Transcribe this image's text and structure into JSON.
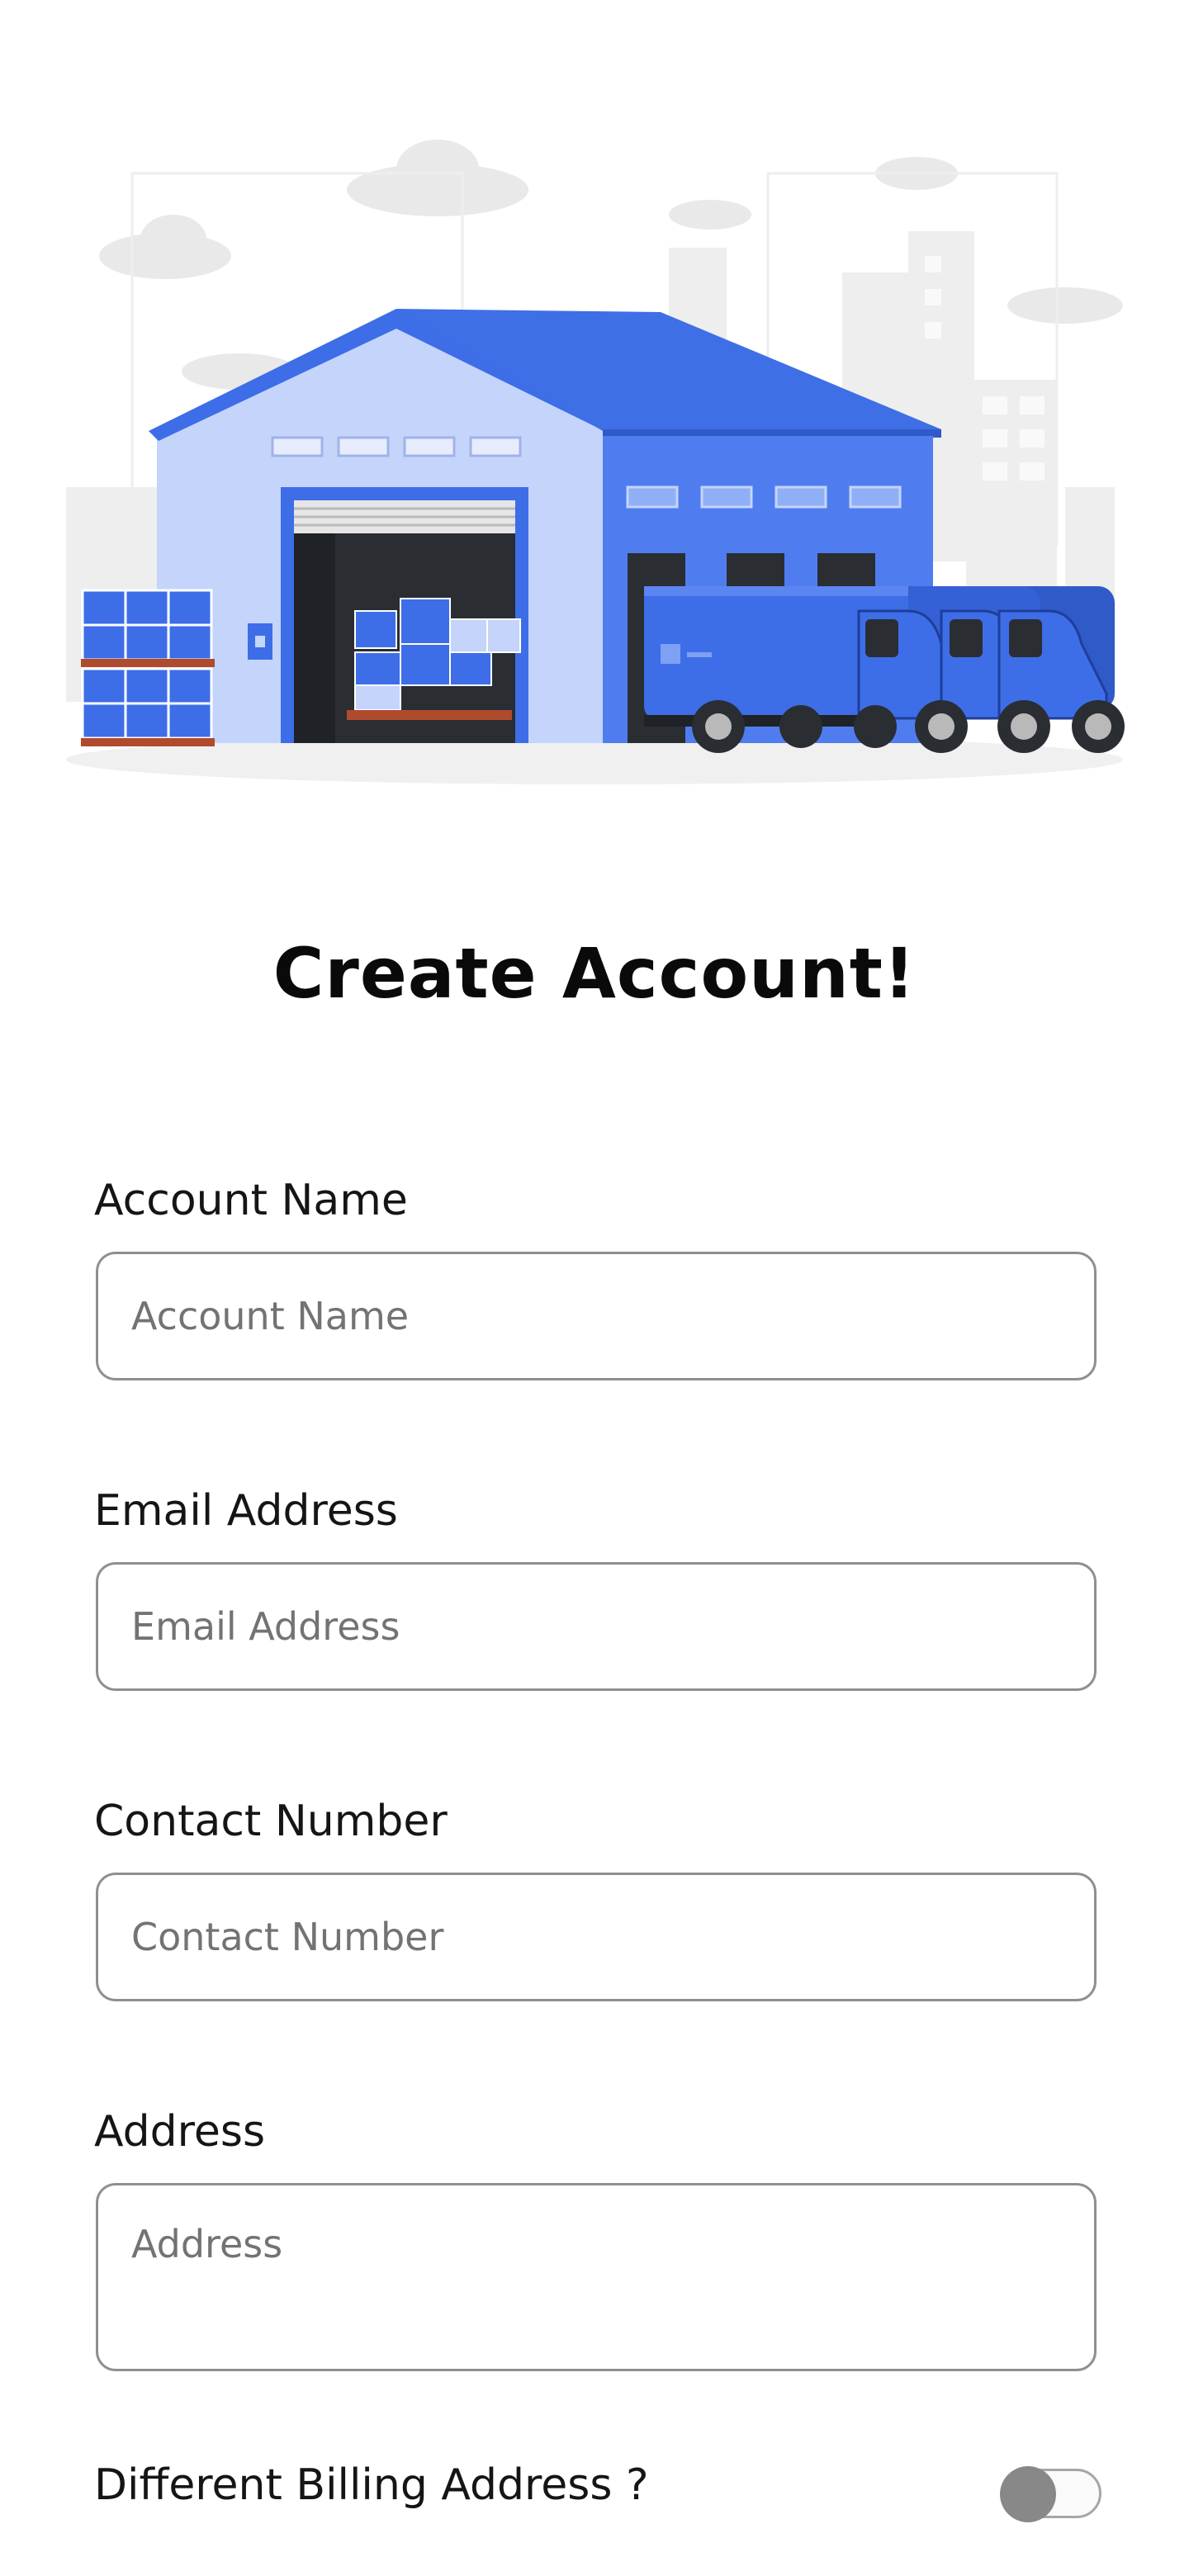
{
  "page": {
    "title": "Create Account!"
  },
  "illustration": {
    "name": "warehouse-with-delivery-vans"
  },
  "form": {
    "account_name": {
      "label": "Account Name",
      "placeholder": "Account Name",
      "value": ""
    },
    "email": {
      "label": "Email Address",
      "placeholder": "Email Address",
      "value": ""
    },
    "contact": {
      "label": "Contact Number",
      "placeholder": "Contact Number",
      "value": ""
    },
    "address": {
      "label": "Address",
      "placeholder": "Address",
      "value": ""
    },
    "billing": {
      "label": "Different Billing Address ?",
      "enabled": false
    }
  },
  "colors": {
    "brand_blue": "#3d6ee8",
    "light_blue": "#c5d4fb",
    "dark_charcoal": "#2a2e33",
    "toggle_off": "#888888"
  }
}
